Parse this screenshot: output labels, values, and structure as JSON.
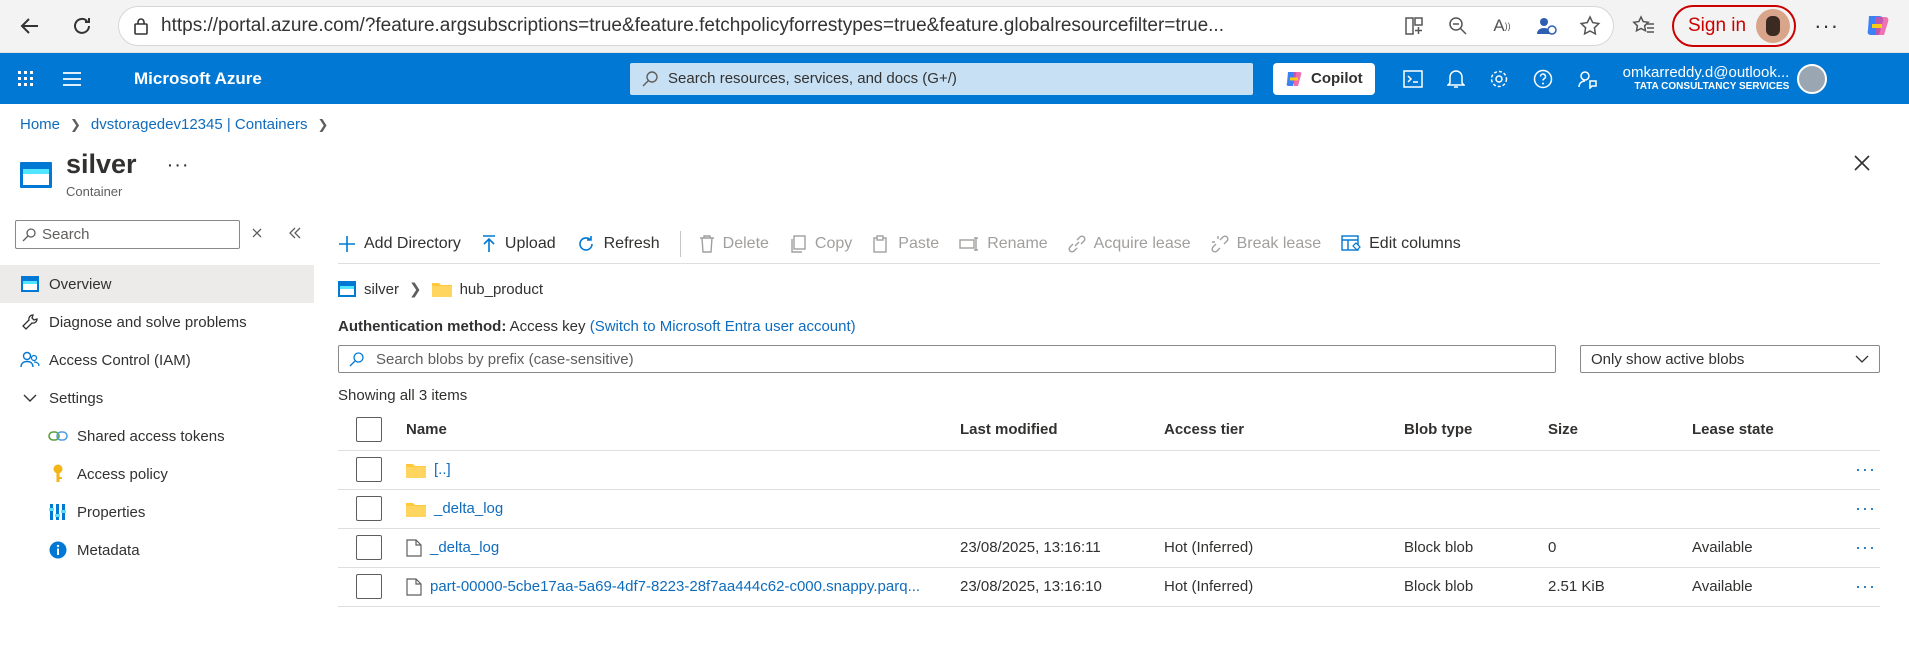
{
  "browser": {
    "url": "https://portal.azure.com/?feature.argsubscriptions=true&feature.fetchpolicyforrestypes=true&feature.globalresourcefilter=true...",
    "signin_label": "Sign in"
  },
  "topbar": {
    "brand": "Microsoft Azure",
    "search_placeholder": "Search resources, services, and docs (G+/)",
    "copilot_label": "Copilot",
    "account_email": "omkarreddy.d@outlook...",
    "account_org": "TATA CONSULTANCY SERVICES"
  },
  "breadcrumb": {
    "items": [
      "Home",
      "dvstoragedev12345 | Containers"
    ]
  },
  "page": {
    "title": "silver",
    "subtitle": "Container",
    "more": "···"
  },
  "left_nav": {
    "search_placeholder": "Search",
    "items": [
      {
        "label": "Overview"
      },
      {
        "label": "Diagnose and solve problems"
      },
      {
        "label": "Access Control (IAM)"
      },
      {
        "label": "Settings"
      },
      {
        "label": "Shared access tokens"
      },
      {
        "label": "Access policy"
      },
      {
        "label": "Properties"
      },
      {
        "label": "Metadata"
      }
    ]
  },
  "toolbar": {
    "add_directory": "Add Directory",
    "upload": "Upload",
    "refresh": "Refresh",
    "delete": "Delete",
    "copy": "Copy",
    "paste": "Paste",
    "rename": "Rename",
    "acquire_lease": "Acquire lease",
    "break_lease": "Break lease",
    "edit_columns": "Edit columns"
  },
  "path": {
    "container": "silver",
    "folder": "hub_product"
  },
  "auth": {
    "label": "Authentication method:",
    "value": "Access key",
    "switch_link": "(Switch to Microsoft Entra user account)"
  },
  "blob_search_placeholder": "Search blobs by prefix (case-sensitive)",
  "blob_filter": "Only show active blobs",
  "showing": "Showing all 3 items",
  "table": {
    "headers": [
      "Name",
      "Last modified",
      "Access tier",
      "Blob type",
      "Size",
      "Lease state"
    ],
    "rows": [
      {
        "name": "[..]",
        "kind": "folder",
        "modified": "",
        "tier": "",
        "type": "",
        "size": "",
        "lease": ""
      },
      {
        "name": "_delta_log",
        "kind": "folder",
        "modified": "",
        "tier": "",
        "type": "",
        "size": "",
        "lease": ""
      },
      {
        "name": "_delta_log",
        "kind": "file",
        "modified": "23/08/2025, 13:16:11",
        "tier": "Hot (Inferred)",
        "type": "Block blob",
        "size": "0",
        "lease": "Available"
      },
      {
        "name": "part-00000-5cbe17aa-5a69-4df7-8223-28f7aa444c62-c000.snappy.parq...",
        "kind": "file",
        "modified": "23/08/2025, 13:16:10",
        "tier": "Hot (Inferred)",
        "type": "Block blob",
        "size": "2.51 KiB",
        "lease": "Available"
      }
    ]
  },
  "colors": {
    "azure_blue": "#0078d4",
    "link": "#0f6cbd",
    "folder": "#ffc83d",
    "signin_red": "#cc0000"
  }
}
